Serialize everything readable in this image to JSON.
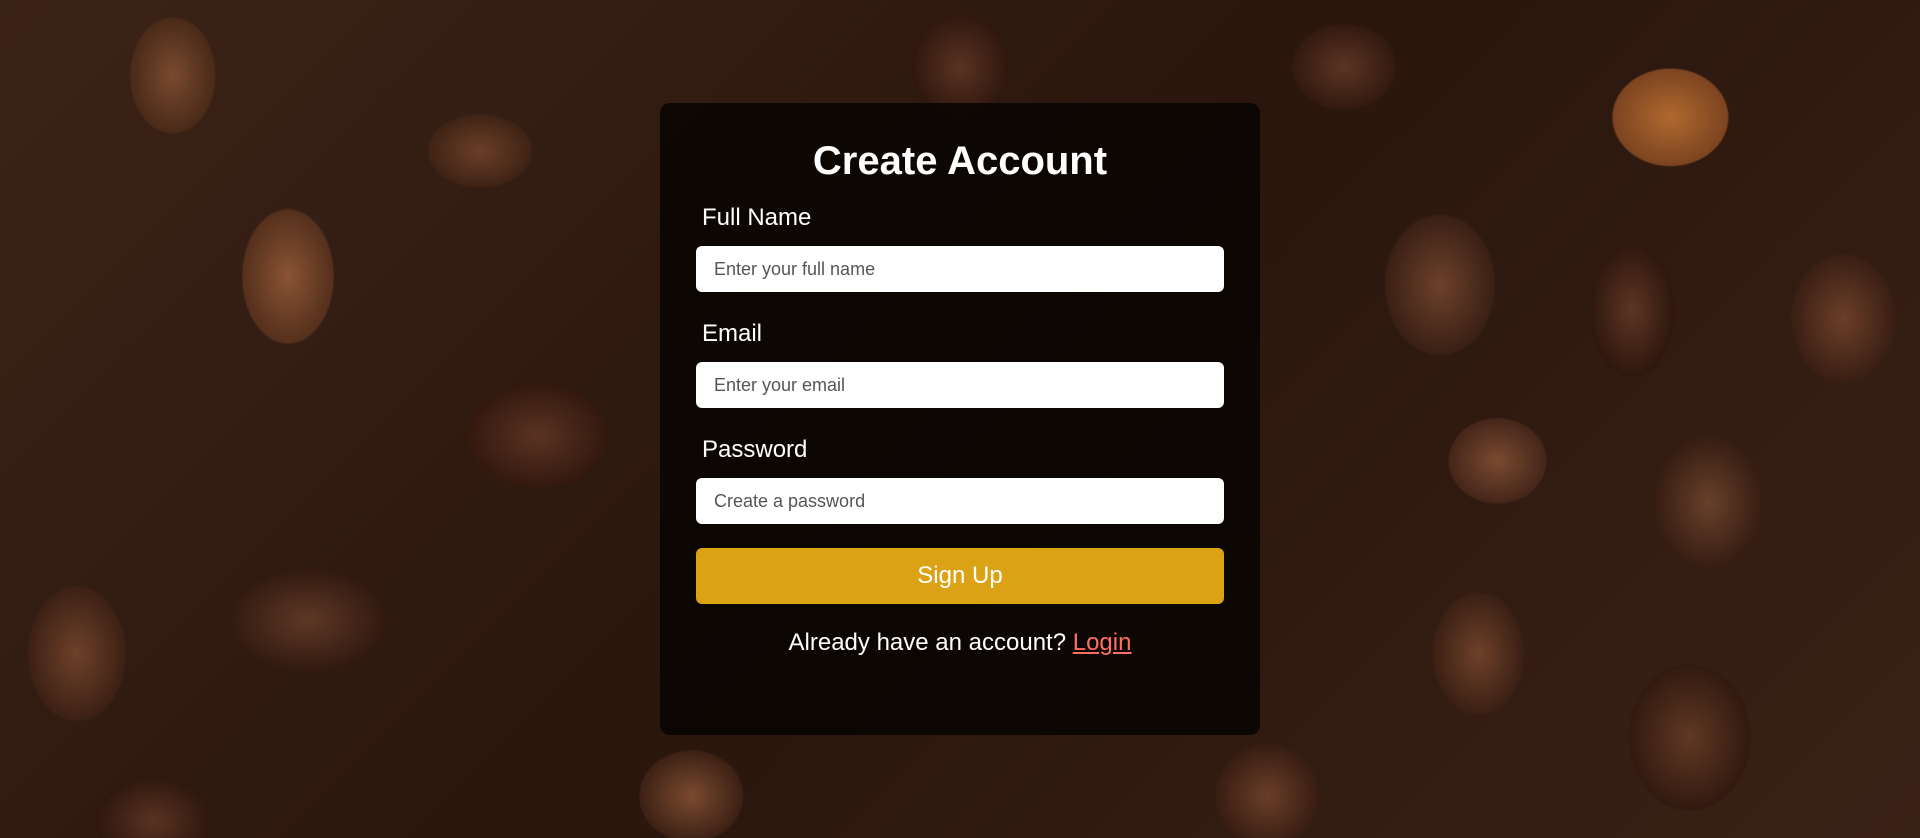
{
  "form": {
    "title": "Create Account",
    "fields": [
      {
        "label": "Full Name",
        "placeholder": "Enter your full name",
        "value": ""
      },
      {
        "label": "Email",
        "placeholder": "Enter your email",
        "value": ""
      },
      {
        "label": "Password",
        "placeholder": "Create a password",
        "value": ""
      }
    ],
    "submit_label": "Sign Up",
    "footer_text": "Already have an account?",
    "login_link_label": "Login"
  },
  "colors": {
    "button": "#dba215",
    "link": "#ff6f61",
    "card_overlay": "rgba(0,0,0,0.72)"
  }
}
